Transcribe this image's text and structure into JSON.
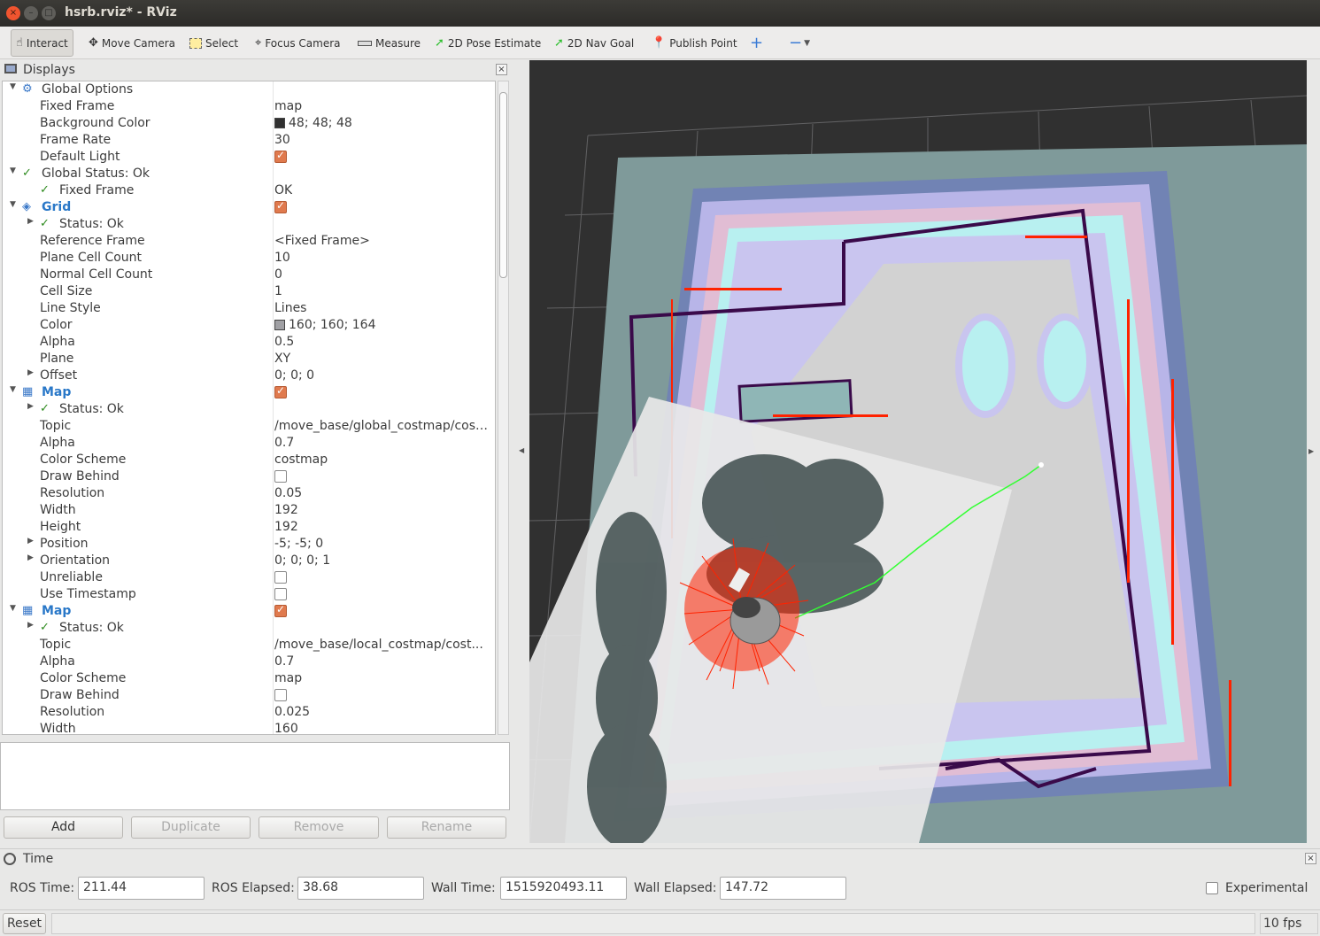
{
  "window": {
    "title": "hsrb.rviz* - RViz",
    "close": "×",
    "min": "–",
    "max": "□"
  },
  "toolbar": [
    {
      "label": "Interact",
      "icon": "hand-icon"
    },
    {
      "label": "Move Camera",
      "icon": "move-camera-icon"
    },
    {
      "label": "Select",
      "icon": "select-icon"
    },
    {
      "label": "Focus Camera",
      "icon": "focus-camera-icon"
    },
    {
      "label": "Measure",
      "icon": "ruler-icon"
    },
    {
      "label": "2D Pose Estimate",
      "icon": "green-arrow-icon"
    },
    {
      "label": "2D Nav Goal",
      "icon": "green-arrow-icon"
    },
    {
      "label": "Publish Point",
      "icon": "pin-icon"
    },
    {
      "label": "+",
      "icon": "plus-icon"
    },
    {
      "label": "−",
      "icon": "minus-icon"
    }
  ],
  "displays": {
    "title": "Displays",
    "close": "×",
    "rows": [
      {
        "indent": 0,
        "arrow": "▼",
        "icon": "⚙",
        "icon_name": "gear-icon",
        "name": "Global Options",
        "value": "",
        "style": "normal"
      },
      {
        "indent": 1,
        "name": "Fixed Frame",
        "value": "map"
      },
      {
        "indent": 1,
        "name": "Background Color",
        "value": "48; 48; 48",
        "swatch": "#303030"
      },
      {
        "indent": 1,
        "name": "Frame Rate",
        "value": "30"
      },
      {
        "indent": 1,
        "name": "Default Light",
        "value": "",
        "check": true
      },
      {
        "indent": 0,
        "arrow": "▼",
        "icon": "✓",
        "icon_name": "check-icon",
        "name": "Global Status: Ok",
        "value": "",
        "status": true
      },
      {
        "indent": 1,
        "icon": "✓",
        "icon_name": "check-icon",
        "name": "Fixed Frame",
        "value": "OK",
        "status": true
      },
      {
        "indent": 0,
        "arrow": "▼",
        "icon": "◈",
        "icon_name": "grid-icon",
        "name": "Grid",
        "value": "",
        "style": "blue",
        "check": true
      },
      {
        "indent": 1,
        "arrow": "▶",
        "icon": "✓",
        "icon_name": "check-icon",
        "name": "Status: Ok",
        "value": "",
        "status": true
      },
      {
        "indent": 1,
        "name": "Reference Frame",
        "value": "<Fixed Frame>"
      },
      {
        "indent": 1,
        "name": "Plane Cell Count",
        "value": "10"
      },
      {
        "indent": 1,
        "name": "Normal Cell Count",
        "value": "0"
      },
      {
        "indent": 1,
        "name": "Cell Size",
        "value": "1"
      },
      {
        "indent": 1,
        "name": "Line Style",
        "value": "Lines"
      },
      {
        "indent": 1,
        "name": "Color",
        "value": "160; 160; 164",
        "swatch": "#a0a0a4"
      },
      {
        "indent": 1,
        "name": "Alpha",
        "value": "0.5"
      },
      {
        "indent": 1,
        "name": "Plane",
        "value": "XY"
      },
      {
        "indent": 1,
        "arrow": "▶",
        "name": "Offset",
        "value": "0; 0; 0"
      },
      {
        "indent": 0,
        "arrow": "▼",
        "icon": "▦",
        "icon_name": "map-icon",
        "name": "Map",
        "value": "",
        "style": "blue",
        "check": true
      },
      {
        "indent": 1,
        "arrow": "▶",
        "icon": "✓",
        "icon_name": "check-icon",
        "name": "Status: Ok",
        "value": "",
        "status": true
      },
      {
        "indent": 1,
        "name": "Topic",
        "value": "/move_base/global_costmap/cost..."
      },
      {
        "indent": 1,
        "name": "Alpha",
        "value": "0.7"
      },
      {
        "indent": 1,
        "name": "Color Scheme",
        "value": "costmap"
      },
      {
        "indent": 1,
        "name": "Draw Behind",
        "value": "",
        "check": false
      },
      {
        "indent": 1,
        "name": "Resolution",
        "value": "0.05"
      },
      {
        "indent": 1,
        "name": "Width",
        "value": "192"
      },
      {
        "indent": 1,
        "name": "Height",
        "value": "192"
      },
      {
        "indent": 1,
        "arrow": "▶",
        "name": "Position",
        "value": "-5; -5; 0"
      },
      {
        "indent": 1,
        "arrow": "▶",
        "name": "Orientation",
        "value": "0; 0; 0; 1"
      },
      {
        "indent": 1,
        "name": "Unreliable",
        "value": "",
        "check": false
      },
      {
        "indent": 1,
        "name": "Use Timestamp",
        "value": "",
        "check": false
      },
      {
        "indent": 0,
        "arrow": "▼",
        "icon": "▦",
        "icon_name": "map-icon",
        "name": "Map",
        "value": "",
        "style": "blue",
        "check": true
      },
      {
        "indent": 1,
        "arrow": "▶",
        "icon": "✓",
        "icon_name": "check-icon",
        "name": "Status: Ok",
        "value": "",
        "status": true
      },
      {
        "indent": 1,
        "name": "Topic",
        "value": "/move_base/local_costmap/cost..."
      },
      {
        "indent": 1,
        "name": "Alpha",
        "value": "0.7"
      },
      {
        "indent": 1,
        "name": "Color Scheme",
        "value": "map"
      },
      {
        "indent": 1,
        "name": "Draw Behind",
        "value": "",
        "check": false
      },
      {
        "indent": 1,
        "name": "Resolution",
        "value": "0.025"
      },
      {
        "indent": 1,
        "name": "Width",
        "value": "160"
      }
    ]
  },
  "buttons": {
    "add": "Add",
    "duplicate": "Duplicate",
    "remove": "Remove",
    "rename": "Rename"
  },
  "time": {
    "title": "Time",
    "close": "×",
    "ros_time_label": "ROS Time:",
    "ros_time": "211.44",
    "ros_elapsed_label": "ROS Elapsed:",
    "ros_elapsed": "38.68",
    "wall_time_label": "Wall Time:",
    "wall_time": "1515920493.11",
    "wall_elapsed_label": "Wall Elapsed:",
    "wall_elapsed": "147.72",
    "experimental_label": "Experimental"
  },
  "status": {
    "reset": "Reset",
    "fps": "10 fps"
  },
  "colors": {
    "background": "#303030",
    "accent": "#e07a4e",
    "status_ok": "#2e8b1f",
    "laser": "#ff2200",
    "path": "#33ff33"
  }
}
